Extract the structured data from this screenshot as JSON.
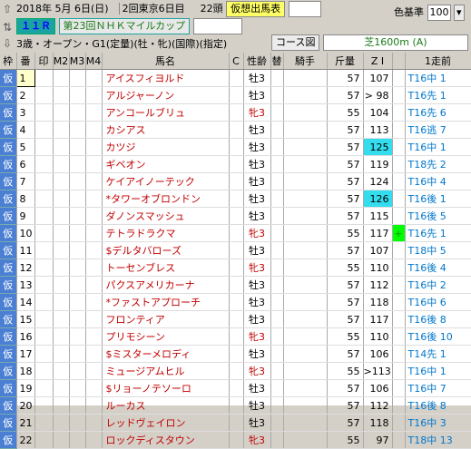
{
  "header": {
    "date": "2018年  5月  6日(日)",
    "meeting": "2回東京6日目",
    "heads": "22頭",
    "mode": "仮想出馬表",
    "color_label": "色基準",
    "color_value": "100",
    "race_no": "１１Ｒ",
    "race_name": "第23回ＮＨＫマイルカップ",
    "condition": "3歳・オープン・G1(定量)(牡・牝)(国際)(指定)",
    "course_label": "コース図",
    "course": "芝1600m  (A)"
  },
  "columns": [
    "枠",
    "番",
    "印",
    "M2",
    "M3",
    "M4",
    "馬名",
    "C",
    "性齢",
    "替",
    "騎手",
    "斤量",
    "Z I",
    "",
    "1走前"
  ],
  "rows": [
    {
      "waku": "仮",
      "ban": "1",
      "name": "アイスフィヨルド",
      "sex": "牡3",
      "kin": "57",
      "zi": "107",
      "mark": "",
      "last": "T16中  1"
    },
    {
      "waku": "仮",
      "ban": "2",
      "name": "アルジャーノン",
      "sex": "牡3",
      "kin": "57",
      "zi": "> 98",
      "mark": "",
      "last": "T16先  1"
    },
    {
      "waku": "仮",
      "ban": "3",
      "name": "アンコールブリュ",
      "sex": "牝3",
      "kin": "55",
      "zi": "104",
      "mark": "",
      "last": "T16先  6"
    },
    {
      "waku": "仮",
      "ban": "4",
      "name": "カシアス",
      "sex": "牡3",
      "kin": "57",
      "zi": "113",
      "mark": "",
      "last": "T16逃  7"
    },
    {
      "waku": "仮",
      "ban": "5",
      "name": "カツジ",
      "sex": "牡3",
      "kin": "57",
      "zi": "125",
      "mark": "",
      "last": "T16中  1"
    },
    {
      "waku": "仮",
      "ban": "6",
      "name": "ギベオン",
      "sex": "牡3",
      "kin": "57",
      "zi": "119",
      "mark": "",
      "last": "T18先  2"
    },
    {
      "waku": "仮",
      "ban": "7",
      "name": "ケイアイノーテック",
      "sex": "牡3",
      "kin": "57",
      "zi": "124",
      "mark": "",
      "last": "T16中  4"
    },
    {
      "waku": "仮",
      "ban": "8",
      "name": "*タワーオブロンドン",
      "sex": "牡3",
      "kin": "57",
      "zi": "126",
      "mark": "",
      "last": "T16後  1"
    },
    {
      "waku": "仮",
      "ban": "9",
      "name": "ダノンスマッシュ",
      "sex": "牡3",
      "kin": "57",
      "zi": "115",
      "mark": "",
      "last": "T16後  5"
    },
    {
      "waku": "仮",
      "ban": "10",
      "name": "テトラドラクマ",
      "sex": "牝3",
      "kin": "55",
      "zi": "117",
      "mark": "+",
      "last": "T16先  1"
    },
    {
      "waku": "仮",
      "ban": "11",
      "name": "$デルタバローズ",
      "sex": "牡3",
      "kin": "57",
      "zi": "107",
      "mark": "",
      "last": "T18中  5"
    },
    {
      "waku": "仮",
      "ban": "12",
      "name": "トーセンブレス",
      "sex": "牝3",
      "kin": "55",
      "zi": "110",
      "mark": "",
      "last": "T16後  4"
    },
    {
      "waku": "仮",
      "ban": "13",
      "name": "パクスアメリカーナ",
      "sex": "牡3",
      "kin": "57",
      "zi": "112",
      "mark": "",
      "last": "T16中  2"
    },
    {
      "waku": "仮",
      "ban": "14",
      "name": "*ファストアプローチ",
      "sex": "牡3",
      "kin": "57",
      "zi": "118",
      "mark": "",
      "last": "T16中  6"
    },
    {
      "waku": "仮",
      "ban": "15",
      "name": "フロンティア",
      "sex": "牡3",
      "kin": "57",
      "zi": "117",
      "mark": "",
      "last": "T16後  8"
    },
    {
      "waku": "仮",
      "ban": "16",
      "name": "プリモシーン",
      "sex": "牝3",
      "kin": "55",
      "zi": "110",
      "mark": "",
      "last": "T16後  10"
    },
    {
      "waku": "仮",
      "ban": "17",
      "name": "$ミスターメロディ",
      "sex": "牡3",
      "kin": "57",
      "zi": "106",
      "mark": "",
      "last": "T14先  1"
    },
    {
      "waku": "仮",
      "ban": "18",
      "name": "ミュージアムヒル",
      "sex": "牝3",
      "kin": "55",
      "zi": ">113",
      "mark": "",
      "last": "T16中  1"
    },
    {
      "waku": "仮",
      "ban": "19",
      "name": "$リョーノテソーロ",
      "sex": "牡3",
      "kin": "57",
      "zi": "106",
      "mark": "",
      "last": "T16中  7"
    },
    {
      "waku": "仮",
      "ban": "20",
      "name": "ルーカス",
      "sex": "牡3",
      "kin": "57",
      "zi": "112",
      "mark": "",
      "last": "T16後  8"
    },
    {
      "waku": "仮",
      "ban": "21",
      "name": "レッドヴェイロン",
      "sex": "牡3",
      "kin": "57",
      "zi": "118",
      "mark": "",
      "last": "T16中  3"
    },
    {
      "waku": "仮",
      "ban": "22",
      "name": "ロックディスタウン",
      "sex": "牝3",
      "kin": "55",
      "zi": "97",
      "mark": "",
      "last": "T18中  13"
    }
  ],
  "highlight_zi": [
    "5",
    "8"
  ],
  "colors": {
    "waku": "#4a7fd4",
    "name": "#c00000",
    "zi_highlight": "#33ddee",
    "last": "#0077cc"
  }
}
